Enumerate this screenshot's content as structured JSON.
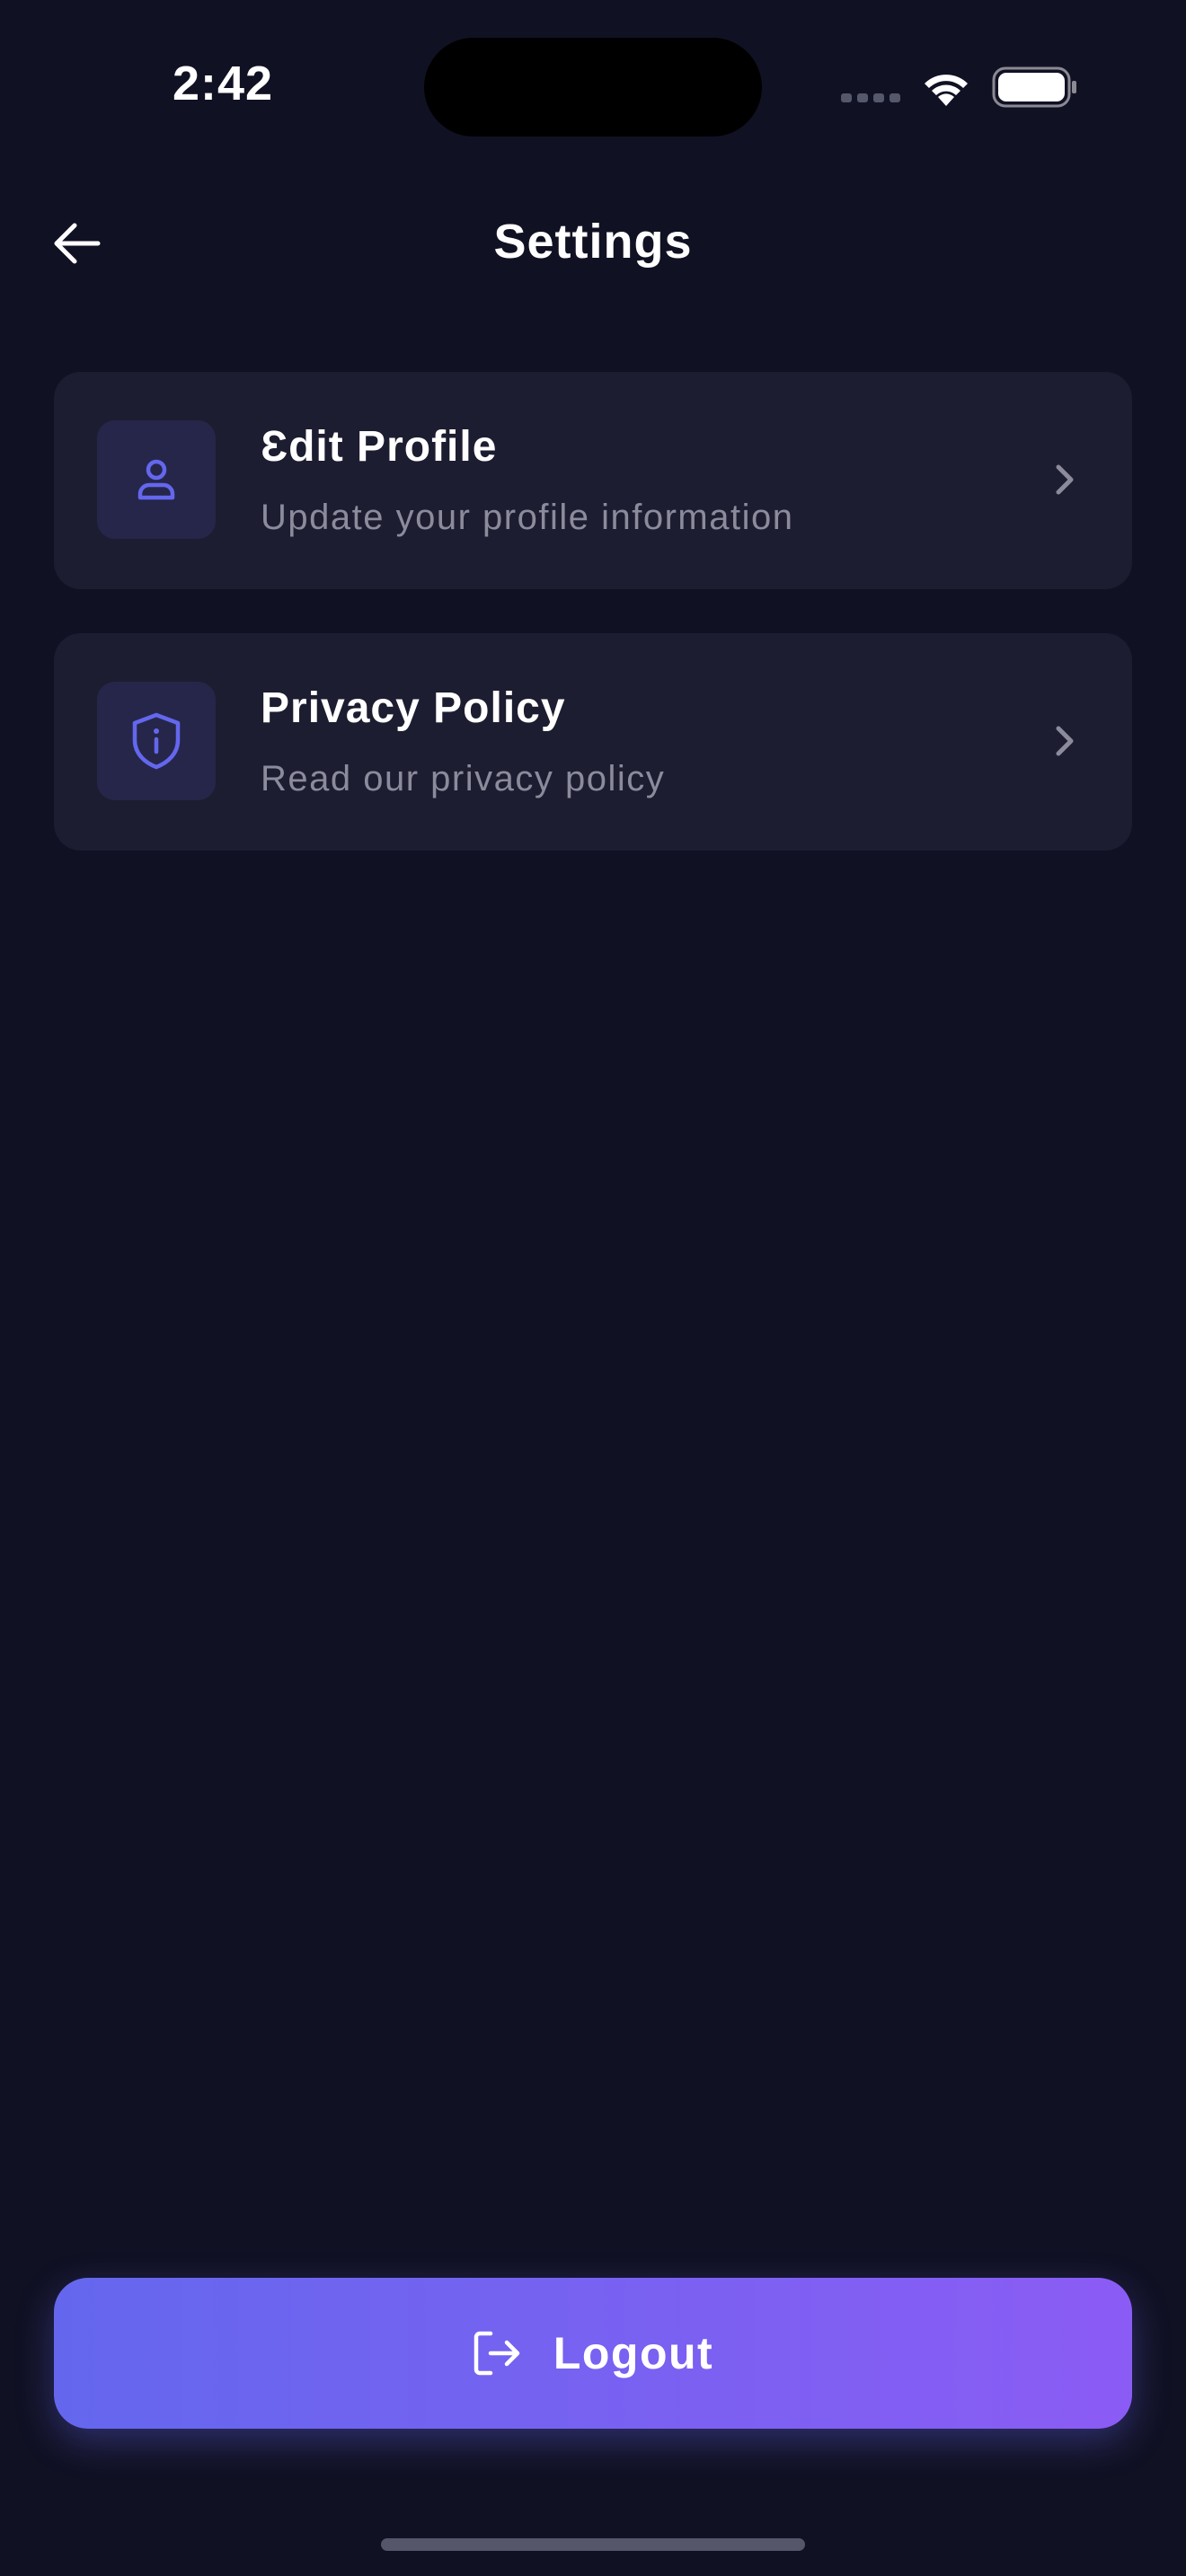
{
  "status": {
    "time": "2:42"
  },
  "header": {
    "title": "Settings"
  },
  "items": [
    {
      "title": "Ɛdit Profile",
      "subtitle": "Update your profile information",
      "icon": "user-icon"
    },
    {
      "title": "Privacy Policy",
      "subtitle": "Read our privacy policy",
      "icon": "shield-info-icon"
    }
  ],
  "logout": {
    "label": "Logout",
    "icon": "logout-icon"
  },
  "colors": {
    "background": "#111124",
    "card": "#1d1d31",
    "accent": "#6467ee",
    "accent_end": "#8b5cf5",
    "subtext": "#8b8b9c"
  }
}
